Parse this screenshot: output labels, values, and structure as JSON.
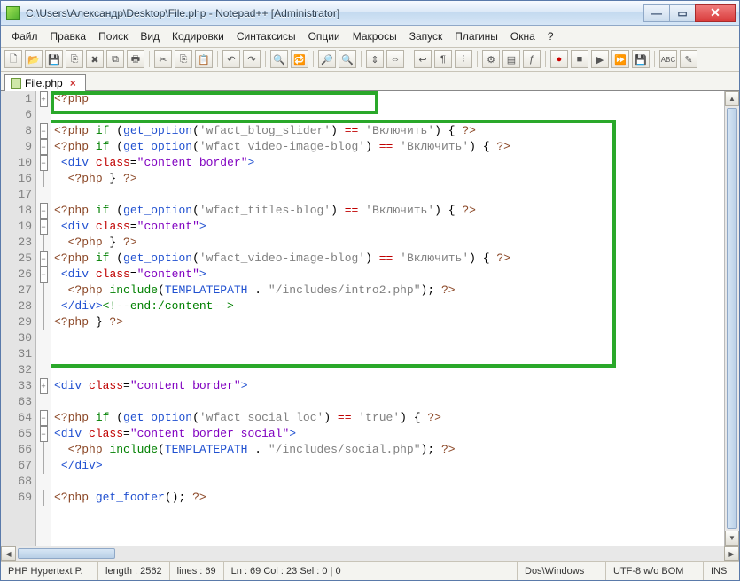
{
  "window": {
    "title": "C:\\Users\\Александр\\Desktop\\File.php - Notepad++ [Administrator]"
  },
  "menu": [
    "Файл",
    "Правка",
    "Поиск",
    "Вид",
    "Кодировки",
    "Синтаксисы",
    "Опции",
    "Макросы",
    "Запуск",
    "Плагины",
    "Окна",
    "?"
  ],
  "tab": {
    "label": "File.php"
  },
  "line_numbers": [
    1,
    6,
    8,
    9,
    10,
    16,
    17,
    18,
    19,
    23,
    25,
    26,
    27,
    28,
    29,
    30,
    31,
    32,
    33,
    63,
    64,
    65,
    66,
    67,
    68,
    69
  ],
  "fold": [
    "plus",
    "",
    "minus",
    "minus",
    "minus",
    "line",
    "",
    "minus",
    "minus",
    "line",
    "minus",
    "minus",
    "line",
    "line",
    "line",
    "",
    "",
    "",
    "plus",
    "",
    "minus",
    "minus",
    "line",
    "line",
    "",
    "line"
  ],
  "code_lines": [
    {
      "html": "<span class='sbrown'>&lt;?php</span>"
    },
    {
      "html": ""
    },
    {
      "html": "<span class='sbrown'>&lt;?php</span> <span class='sgreen'>if</span> (<span class='sblue'>get_option</span>(<span class='sgrey'>'wfact_blog_slider'</span>) <span class='sred'>==</span> <span class='sgrey'>'Включить'</span>) { <span class='sbrown'>?&gt;</span>"
    },
    {
      "html": "<span class='sbrown'>&lt;?php</span> <span class='sgreen'>if</span> (<span class='sblue'>get_option</span>(<span class='sgrey'>'wfact_video-image-blog'</span>) <span class='sred'>==</span> <span class='sgrey'>'Включить'</span>) { <span class='sbrown'>?&gt;</span>"
    },
    {
      "html": "&nbsp;<span class='sblue'>&lt;div</span> <span class='sred'>class</span>=<span class='spurple'>\"content border\"</span><span class='sblue'>&gt;</span>"
    },
    {
      "html": "&nbsp;&nbsp;<span class='sbrown'>&lt;?php</span> } <span class='sbrown'>?&gt;</span>"
    },
    {
      "html": ""
    },
    {
      "html": "<span class='sbrown'>&lt;?php</span> <span class='sgreen'>if</span> (<span class='sblue'>get_option</span>(<span class='sgrey'>'wfact_titles-blog'</span>) <span class='sred'>==</span> <span class='sgrey'>'Включить'</span>) { <span class='sbrown'>?&gt;</span>"
    },
    {
      "html": "&nbsp;<span class='sblue'>&lt;div</span> <span class='sred'>class</span>=<span class='spurple'>\"content\"</span><span class='sblue'>&gt;</span>"
    },
    {
      "html": "&nbsp;&nbsp;<span class='sbrown'>&lt;?php</span> } <span class='sbrown'>?&gt;</span>"
    },
    {
      "html": "<span class='sbrown'>&lt;?php</span> <span class='sgreen'>if</span> (<span class='sblue'>get_option</span>(<span class='sgrey'>'wfact_video-image-blog'</span>) <span class='sred'>==</span> <span class='sgrey'>'Включить'</span>) { <span class='sbrown'>?&gt;</span>"
    },
    {
      "html": "&nbsp;<span class='sblue'>&lt;div</span> <span class='sred'>class</span>=<span class='spurple'>\"content\"</span><span class='sblue'>&gt;</span>"
    },
    {
      "html": "&nbsp;&nbsp;<span class='sbrown'>&lt;?php</span> <span class='sgreen'>include</span>(<span class='sblue'>TEMPLATEPATH</span> . <span class='sgrey'>\"/includes/intro2.php\"</span>); <span class='sbrown'>?&gt;</span>"
    },
    {
      "html": "&nbsp;<span class='sblue'>&lt;/div&gt;</span><span class='sgreen'>&lt;!--end:/content--&gt;</span>"
    },
    {
      "html": "<span class='sbrown'>&lt;?php</span> } <span class='sbrown'>?&gt;</span>"
    },
    {
      "html": ""
    },
    {
      "html": ""
    },
    {
      "html": ""
    },
    {
      "html": "<span class='sblue'>&lt;div</span> <span class='sred'>class</span>=<span class='spurple'>\"content border\"</span><span class='sblue'>&gt;</span>"
    },
    {
      "html": ""
    },
    {
      "html": "<span class='sbrown'>&lt;?php</span> <span class='sgreen'>if</span> (<span class='sblue'>get_option</span>(<span class='sgrey'>'wfact_social_loc'</span>) <span class='sred'>==</span> <span class='sgrey'>'true'</span>) { <span class='sbrown'>?&gt;</span>"
    },
    {
      "html": "<span class='sblue'>&lt;div</span> <span class='sred'>class</span>=<span class='spurple'>\"content border social\"</span><span class='sblue'>&gt;</span>"
    },
    {
      "html": "&nbsp;&nbsp;<span class='sbrown'>&lt;?php</span> <span class='sgreen'>include</span>(<span class='sblue'>TEMPLATEPATH</span> . <span class='sgrey'>\"/includes/social.php\"</span>); <span class='sbrown'>?&gt;</span>"
    },
    {
      "html": "&nbsp;<span class='sblue'>&lt;/div&gt;</span>"
    },
    {
      "html": ""
    },
    {
      "html": "<span class='sbrown'>&lt;?php</span> <span class='sblue'>get_footer</span>(); <span class='sbrown'>?&gt;</span>"
    }
  ],
  "status": {
    "lang": "PHP Hypertext P.",
    "length": "length : 2562",
    "lines": "lines : 69",
    "pos": "Ln : 69   Col : 23   Sel : 0 | 0",
    "eol": "Dos\\Windows",
    "enc": "UTF-8 w/o BOM",
    "mode": "INS"
  }
}
